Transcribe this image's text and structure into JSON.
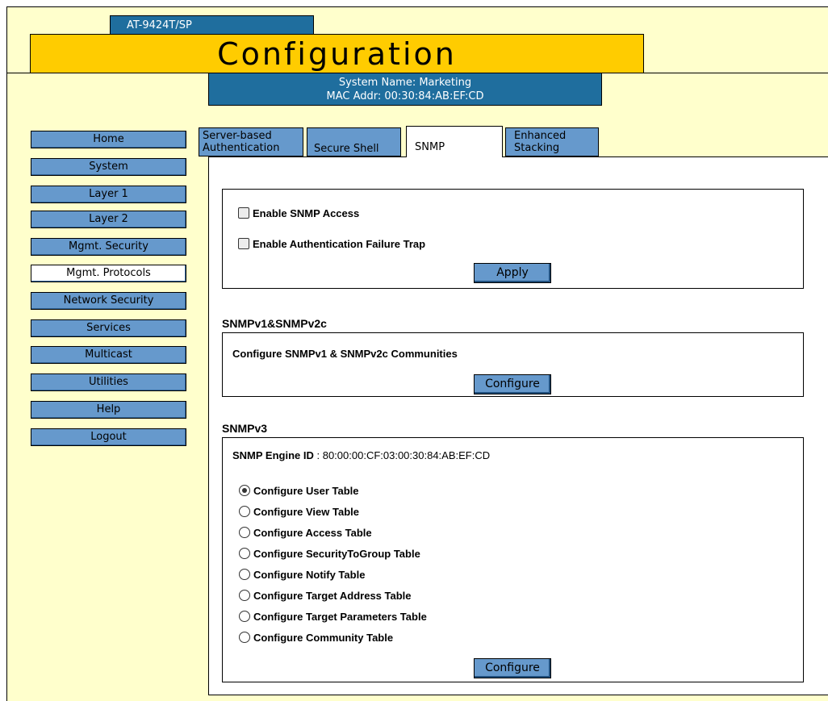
{
  "header": {
    "model": "AT-9424T/SP",
    "title": "Configuration",
    "system_name": "System Name: Marketing",
    "mac_addr": "MAC Addr: 00:30:84:AB:EF:CD"
  },
  "nav": {
    "items": [
      {
        "label": "Home"
      },
      {
        "label": "System"
      },
      {
        "label": "Layer 1"
      },
      {
        "label": "Layer 2"
      },
      {
        "label": "Mgmt. Security"
      },
      {
        "label": "Mgmt. Protocols"
      },
      {
        "label": "Network Security"
      },
      {
        "label": "Services"
      },
      {
        "label": "Multicast"
      },
      {
        "label": "Utilities"
      },
      {
        "label": "Help"
      },
      {
        "label": "Logout"
      }
    ],
    "active": "Mgmt. Protocols"
  },
  "tabs": {
    "items": [
      {
        "line1": "Server-based",
        "line2": "Authentication"
      },
      {
        "line1": "Secure Shell",
        "line2": ""
      },
      {
        "line1": "SNMP",
        "line2": ""
      },
      {
        "line1": "Enhanced",
        "line2": "Stacking"
      }
    ],
    "selected": "SNMP"
  },
  "snmp_access": {
    "enable_snmp_label": "Enable SNMP Access",
    "enable_snmp_checked": false,
    "enable_auth_trap_label": "Enable Authentication Failure Trap",
    "enable_auth_trap_checked": false,
    "apply_label": "Apply"
  },
  "v1v2c": {
    "heading": "SNMPv1&SNMPv2c",
    "description": "Configure SNMPv1 & SNMPv2c Communities",
    "configure_label": "Configure"
  },
  "v3": {
    "heading": "SNMPv3",
    "engine_id_label": "SNMP Engine ID",
    "engine_id_value": " : 80:00:00:CF:03:00:30:84:AB:EF:CD",
    "options": [
      "Configure User Table",
      "Configure View Table",
      "Configure Access Table",
      "Configure SecurityToGroup Table",
      "Configure Notify Table",
      "Configure Target Address Table",
      "Configure Target Parameters Table",
      "Configure Community Table"
    ],
    "selected_option": "Configure User Table",
    "configure_label": "Configure"
  }
}
